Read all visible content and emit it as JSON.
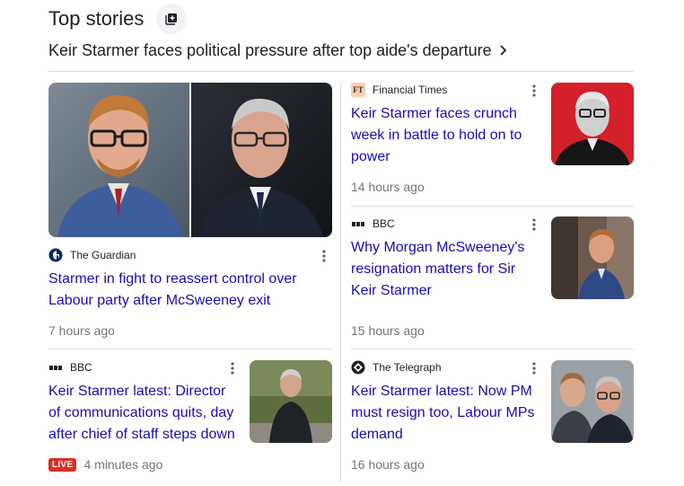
{
  "section": {
    "title": "Top stories",
    "headline": "Keir Starmer faces political pressure after top aide's departure"
  },
  "stories": [
    {
      "source": "The Guardian",
      "title_lines": [
        "Starmer in fight to reassert control over",
        "Labour party after McSweeney exit"
      ],
      "time": "7 hours ago"
    },
    {
      "source": "Financial Times",
      "source_logo_text": "FT",
      "title_lines": [
        "Keir Starmer faces crunch",
        "week in battle to hold on to",
        "power"
      ],
      "time": "14 hours ago"
    },
    {
      "source": "BBC",
      "title_lines": [
        "Why Morgan McSweeney's",
        "resignation matters for Sir",
        "Keir Starmer"
      ],
      "time": "15 hours ago"
    },
    {
      "source": "BBC",
      "title_lines": [
        "Keir Starmer latest: Director",
        "of communications quits, day",
        "after chief of staff steps down"
      ],
      "badge": "LIVE",
      "time": "4 minutes ago"
    },
    {
      "source": "The Telegraph",
      "title_lines": [
        "Keir Starmer latest: Now PM",
        "must resign too, Labour MPs",
        "demand"
      ],
      "time": "16 hours ago"
    }
  ],
  "colors": {
    "link": "#1a0dab",
    "muted": "#70757a",
    "live": "#d93025",
    "divider": "#dadce0"
  }
}
